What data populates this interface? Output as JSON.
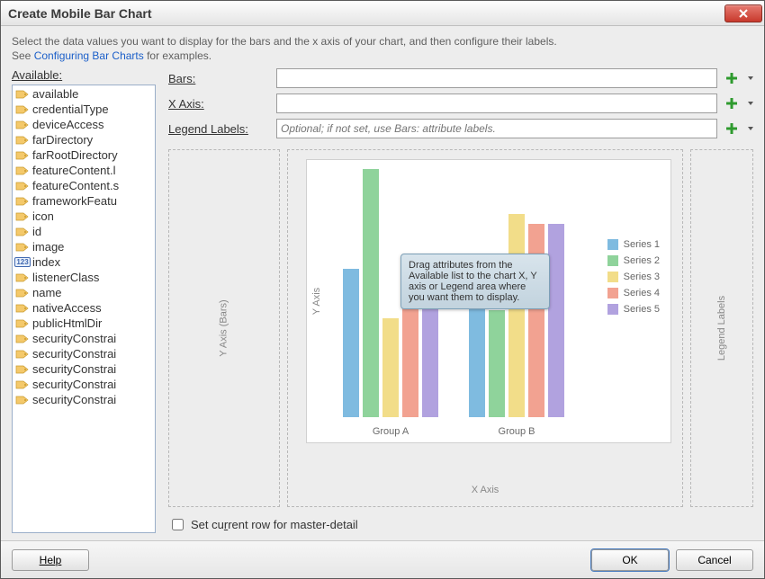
{
  "title": "Create Mobile Bar Chart",
  "description": {
    "line1": "Select the data values you want to display for the bars and the x axis of your chart, and then configure their labels.",
    "line2_pre": "See ",
    "line2_link": "Configuring Bar Charts",
    "line2_post": " for examples."
  },
  "available": {
    "header": "Available:",
    "items": [
      {
        "label": "available",
        "icon": "tag"
      },
      {
        "label": "credentialType",
        "icon": "tag"
      },
      {
        "label": "deviceAccess",
        "icon": "tag"
      },
      {
        "label": "farDirectory",
        "icon": "tag"
      },
      {
        "label": "farRootDirectory",
        "icon": "tag"
      },
      {
        "label": "featureContent.l",
        "icon": "tag"
      },
      {
        "label": "featureContent.s",
        "icon": "tag"
      },
      {
        "label": "frameworkFeatu",
        "icon": "tag"
      },
      {
        "label": "icon",
        "icon": "tag"
      },
      {
        "label": "id",
        "icon": "tag"
      },
      {
        "label": "image",
        "icon": "tag"
      },
      {
        "label": "index",
        "icon": "num"
      },
      {
        "label": "listenerClass",
        "icon": "tag"
      },
      {
        "label": "name",
        "icon": "tag"
      },
      {
        "label": "nativeAccess",
        "icon": "tag"
      },
      {
        "label": "publicHtmlDir",
        "icon": "tag"
      },
      {
        "label": "securityConstrai",
        "icon": "tag"
      },
      {
        "label": "securityConstrai",
        "icon": "tag"
      },
      {
        "label": "securityConstrai",
        "icon": "tag"
      },
      {
        "label": "securityConstrai",
        "icon": "tag"
      },
      {
        "label": "securityConstrai",
        "icon": "tag"
      }
    ]
  },
  "form": {
    "bars_label": "Bars:",
    "xaxis_label": "X Axis:",
    "legend_label": "Legend Labels:",
    "legend_placeholder": "Optional; if not set, use Bars: attribute labels.",
    "bars_value": "",
    "xaxis_value": "",
    "legend_value": ""
  },
  "preview": {
    "ybars_label": "Y Axis (Bars)",
    "yaxis_label": "Y Axis",
    "xaxis_label": "X Axis",
    "legend_zone_label": "Legend Labels",
    "tooltip": "Drag attributes from the Available list to the chart X, Y axis or Legend area where you want them to display.",
    "group_a": "Group A",
    "group_b": "Group B",
    "legend": [
      "Series 1",
      "Series 2",
      "Series 3",
      "Series 4",
      "Series 5"
    ]
  },
  "check_label_pre": "Set cu",
  "check_label_u": "r",
  "check_label_post": "rent row for master-detail",
  "buttons": {
    "help": "Help",
    "ok": "OK",
    "cancel": "Cancel"
  },
  "num_badge": "123",
  "chart_data": {
    "type": "bar",
    "categories": [
      "Group A",
      "Group B"
    ],
    "series": [
      {
        "name": "Series 1",
        "values": [
          60,
          47
        ],
        "color": "#7fbbe0"
      },
      {
        "name": "Series 2",
        "values": [
          100,
          43
        ],
        "color": "#8fd39b"
      },
      {
        "name": "Series 3",
        "values": [
          40,
          82
        ],
        "color": "#f2dd89"
      },
      {
        "name": "Series 4",
        "values": [
          45,
          78
        ],
        "color": "#f2a291"
      },
      {
        "name": "Series 5",
        "values": [
          65,
          78
        ],
        "color": "#b1a2df"
      }
    ],
    "xlabel": "X Axis",
    "ylabel": "Y Axis",
    "ylim": [
      0,
      100
    ],
    "legend_position": "right"
  }
}
